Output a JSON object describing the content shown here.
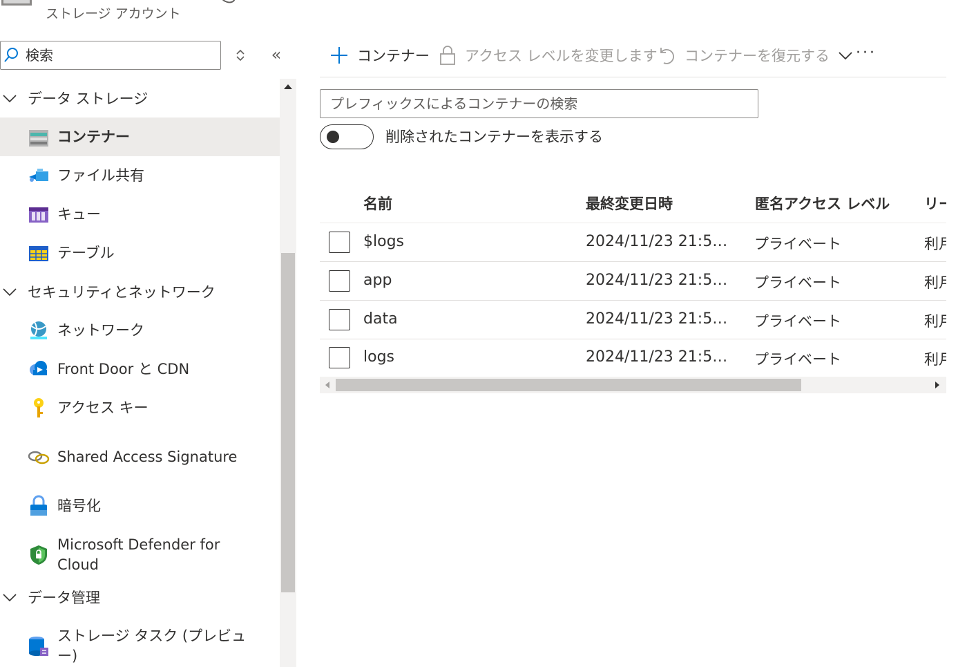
{
  "header": {
    "subtitle": "ストレージ アカウント"
  },
  "sidebar": {
    "search_placeholder": "検索",
    "collapse_glyph": "«",
    "groups": [
      {
        "label": "データ ストレージ"
      },
      {
        "label": "セキュリティとネットワーク"
      },
      {
        "label": "データ管理"
      }
    ],
    "items": [
      {
        "label": "コンテナー",
        "selected": true
      },
      {
        "label": "ファイル共有"
      },
      {
        "label": "キュー"
      },
      {
        "label": "テーブル"
      },
      {
        "label": "ネットワーク"
      },
      {
        "label": "Front Door と CDN"
      },
      {
        "label": "アクセス キー"
      },
      {
        "label": "Shared Access Signature"
      },
      {
        "label": "暗号化"
      },
      {
        "label": "Microsoft Defender for Cloud"
      },
      {
        "label": "ストレージ タスク (プレビュー)"
      }
    ]
  },
  "toolbar": {
    "add_container": "コンテナー",
    "change_access_level": "アクセス レベルを変更します",
    "restore_container": "コンテナーを復元する",
    "more": "···"
  },
  "filter": {
    "placeholder": "プレフィックスによるコンテナーの検索"
  },
  "toggle": {
    "label": "削除されたコンテナーを表示する",
    "on": false
  },
  "table": {
    "columns": [
      "名前",
      "最終変更日時",
      "匿名アクセス レベル",
      "リー"
    ],
    "rows": [
      {
        "name": "$logs",
        "modified": "2024/11/23 21:5…",
        "access": "プライベート",
        "lease": "利月"
      },
      {
        "name": "app",
        "modified": "2024/11/23 21:5…",
        "access": "プライベート",
        "lease": "利月"
      },
      {
        "name": "data",
        "modified": "2024/11/23 21:5…",
        "access": "プライベート",
        "lease": "利月"
      },
      {
        "name": "logs",
        "modified": "2024/11/23 21:5…",
        "access": "プライベート",
        "lease": "利月"
      }
    ]
  },
  "colors": {
    "accent": "#0078d4",
    "selected_bg": "#edebe9",
    "text": "#323130",
    "muted": "#605e5c"
  }
}
